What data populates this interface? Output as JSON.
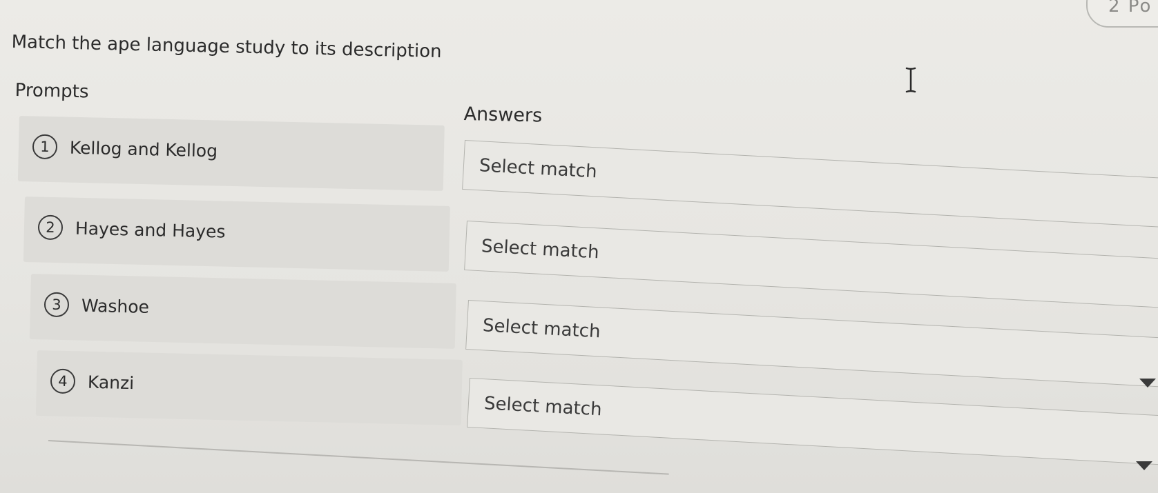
{
  "header": {
    "points_text": "2 Po"
  },
  "question": {
    "text": "Match the ape language study to its description"
  },
  "prompts": {
    "heading": "Prompts",
    "items": [
      {
        "number": "1",
        "label": "Kellog and Kellog"
      },
      {
        "number": "2",
        "label": "Hayes and Hayes"
      },
      {
        "number": "3",
        "label": "Washoe"
      },
      {
        "number": "4",
        "label": "Kanzi"
      }
    ]
  },
  "answers": {
    "heading": "Answers",
    "items": [
      {
        "value": "Select match"
      },
      {
        "value": "Select match"
      },
      {
        "value": "Select match"
      },
      {
        "value": "Select match"
      }
    ]
  },
  "icons": {
    "cursor": "text-cursor-icon",
    "dropdown": "chevron-down-icon"
  }
}
